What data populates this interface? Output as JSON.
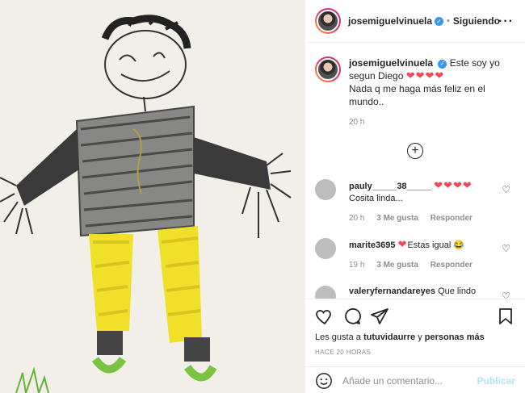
{
  "header": {
    "username": "josemiguelvinuela",
    "follow_status": "Siguiendo",
    "verified_icon": "verified-badge-icon",
    "more_icon": "more-options-icon"
  },
  "caption": {
    "username": "josemiguelvinuela",
    "text_line1": "Este soy yo segun Diego",
    "hearts": "❤❤❤❤",
    "text_line2": "Nada q me haga más feliz en el mundo..",
    "time": "20 h"
  },
  "comments": [
    {
      "username": "pauly_____38_____",
      "hearts": "❤❤❤❤",
      "text": "Cosita linda...",
      "time": "20 h",
      "likes": "3 Me gusta",
      "reply": "Responder"
    },
    {
      "username": "marite3695",
      "hearts": "❤",
      "text": "Estas igual 😂",
      "time": "19 h",
      "likes": "3 Me gusta",
      "reply": "Responder"
    },
    {
      "username": "valeryfernandareyes",
      "text": "Que lindo"
    }
  ],
  "likes": {
    "prefix": "Les gusta a",
    "user": "tutuvidaurre",
    "connector": "y",
    "others": "personas más"
  },
  "post_time": "HACE 20 HORAS",
  "comment_box": {
    "placeholder": "Añade un comentario...",
    "publish": "Publicar"
  },
  "colors": {
    "accent": "#0095f6",
    "heart": "#ed4956",
    "publish_disabled": "#b2dffc"
  }
}
